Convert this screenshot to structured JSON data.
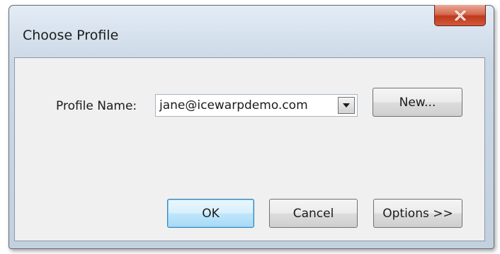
{
  "window": {
    "title": "Choose Profile",
    "close_glyph": "close-icon"
  },
  "form": {
    "profile_label": "Profile Name:",
    "profile_value": "jane@icewarpdemo.com",
    "new_button": "New..."
  },
  "buttons": {
    "ok": "OK",
    "cancel": "Cancel",
    "options": "Options >>"
  },
  "colors": {
    "title_bar": "#d7e2ee",
    "close_button": "#c0391c",
    "client_area": "#f0f0f0",
    "default_button": "#bee6fd"
  }
}
